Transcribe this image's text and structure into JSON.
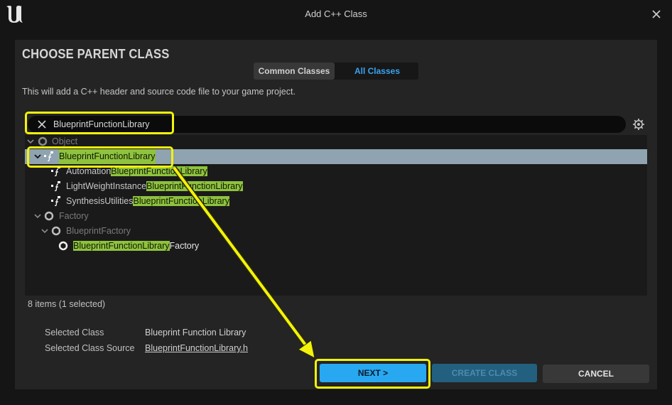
{
  "window": {
    "title": "Add C++ Class",
    "logo_icon": "unreal-logo-icon",
    "close_icon": "close-icon"
  },
  "header": {
    "title": "CHOOSE PARENT CLASS"
  },
  "tabs": [
    {
      "label": "Common Classes",
      "active": false
    },
    {
      "label": "All Classes",
      "active": true
    }
  ],
  "description": "This will add a C++ header and source code file to your game project.",
  "search": {
    "value": "BlueprintFunctionLibrary"
  },
  "tree": {
    "object": "Object",
    "bfl": "BlueprintFunctionLibrary",
    "automation_pre": "Automation",
    "automation_hl": "BlueprintFunctionLibrary",
    "lightweight_pre": "LightWeightInstance",
    "lightweight_hl": "BlueprintFunctionLibrary",
    "synthesis_pre": "SynthesisUtilities",
    "synthesis_hl": "BlueprintFunctionLibrary",
    "factory": "Factory",
    "bp_factory": "BlueprintFactory",
    "bfl_factory_hl": "BlueprintFunctionLibrary",
    "bfl_factory_post": "Factory"
  },
  "count": "8 items (1 selected)",
  "details": {
    "class_label": "Selected Class",
    "class_value": "Blueprint Function Library",
    "source_label": "Selected Class Source",
    "source_value": "BlueprintFunctionLibrary.h"
  },
  "buttons": {
    "next": "NEXT >",
    "create": "CREATE CLASS",
    "cancel": "CANCEL"
  },
  "colors": {
    "highlight": "#8fc23e",
    "selection": "#8fa3b0",
    "accent": "#28a8f0",
    "annotation": "#f2f20c"
  }
}
